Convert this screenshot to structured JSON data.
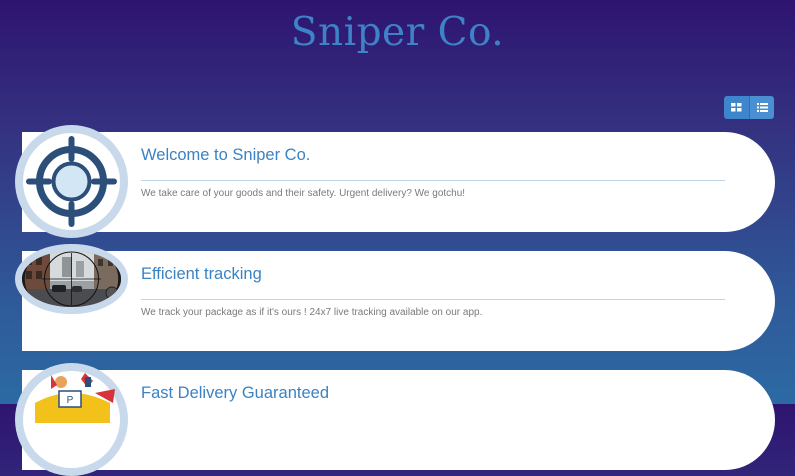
{
  "site": {
    "title": "Sniper Co."
  },
  "view_toggle": {
    "grid_icon": "grid-view-icon",
    "list_icon": "list-view-icon",
    "accent": "#3d86cc"
  },
  "cards": [
    {
      "title": "Welcome to Sniper Co.",
      "text": "We take care of your goods and their safety. Urgent delivery? We gotchu!",
      "avatar": "crosshair-icon"
    },
    {
      "title": "Efficient tracking",
      "text": "We track your package as if it's ours ! 24x7 live tracking available on our app.",
      "avatar": "scope-street-photo"
    },
    {
      "title": "Fast Delivery Guaranteed",
      "text": "",
      "avatar": "delivery-superhero-icon"
    }
  ],
  "colors": {
    "title": "#3e82c8",
    "card_title": "#3b82c4",
    "bg_top": "#2e1470",
    "bg_bottom": "#2c6aa4"
  }
}
